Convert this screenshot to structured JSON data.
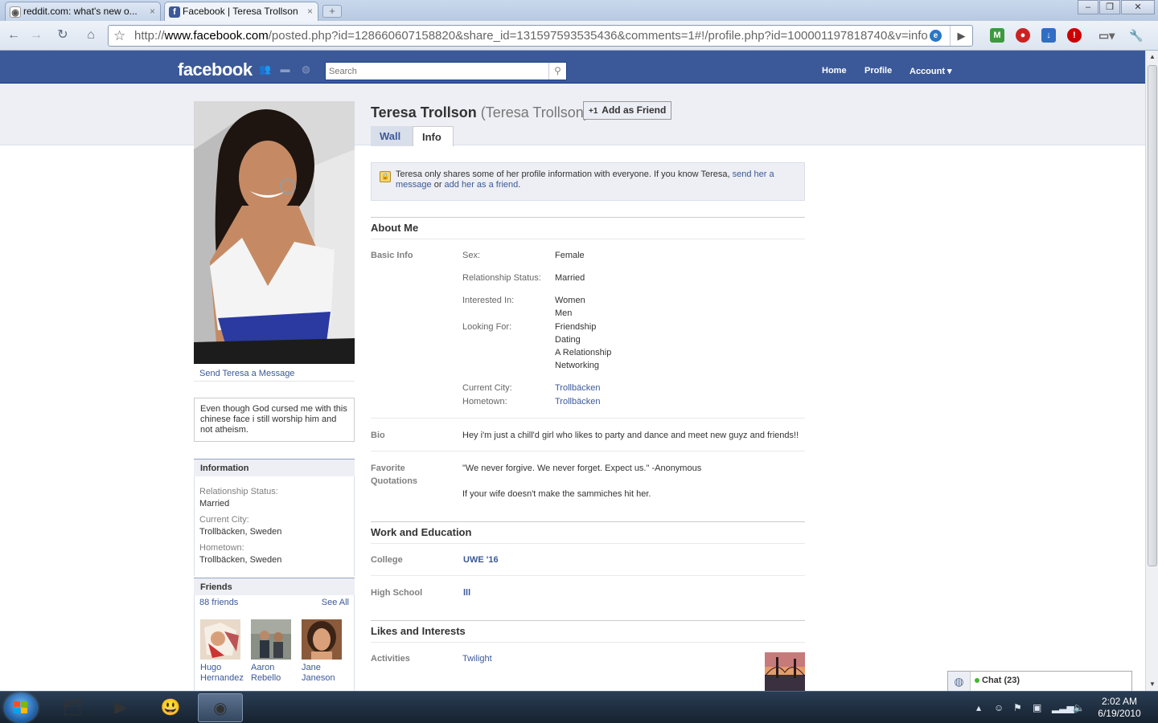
{
  "browser": {
    "tabs": [
      {
        "title": "reddit.com: what's new o...",
        "close": "×"
      },
      {
        "title": "Facebook | Teresa Trollson",
        "close": "×"
      }
    ],
    "url_prefix": "http://",
    "url_host": "www.facebook.com",
    "url_rest": "/posted.php?id=128660607158820&share_id=131597593535436&comments=1#!/profile.php?id=100001197818740&v=info"
  },
  "fb": {
    "logo": "facebook",
    "search_placeholder": "Search",
    "nav": {
      "home": "Home",
      "profile": "Profile",
      "account": "Account ▾"
    },
    "accent": "#3b5998"
  },
  "profile": {
    "name": "Teresa Trollson",
    "alt_name": "(Teresa Trollson)",
    "add_friend": "Add as Friend",
    "tabs": [
      "Wall",
      "Info"
    ],
    "send_message": "Send Teresa a Message",
    "bio_box": "Even though God cursed me with this chinese face i still worship him and not atheism.",
    "privacy": {
      "text": "Teresa only shares some of her profile information with everyone. If you know Teresa,",
      "link1": "send her a message",
      "or": "or",
      "link2": "add her as a friend",
      "end": "."
    }
  },
  "sidebar": {
    "information_title": "Information",
    "relationship_label": "Relationship Status:",
    "relationship_value": "Married",
    "city_label": "Current City:",
    "city_value": "Trollbäcken, Sweden",
    "hometown_label": "Hometown:",
    "hometown_value": "Trollbäcken, Sweden",
    "friends_title": "Friends",
    "friends_count": "88 friends",
    "see_all": "See All",
    "friends": [
      {
        "first": "Hugo",
        "last": "Hernandez"
      },
      {
        "first": "Aaron",
        "last": "Rebello"
      },
      {
        "first": "Jane",
        "last": "Janeson"
      }
    ]
  },
  "about": {
    "title": "About Me",
    "basic_info": "Basic Info",
    "sex_label": "Sex:",
    "sex": "Female",
    "rel_label": "Relationship Status:",
    "rel": "Married",
    "interested_label": "Interested In:",
    "interested": [
      "Women",
      "Men"
    ],
    "looking_label": "Looking For:",
    "looking": [
      "Friendship",
      "Dating",
      "A Relationship",
      "Networking"
    ],
    "city_label": "Current City:",
    "city": "Trollbäcken",
    "hometown_label": "Hometown:",
    "hometown": "Trollbäcken",
    "bio_label": "Bio",
    "bio": "Hey i'm just a chill'd girl who likes to party and dance and meet new guyz and friends!!",
    "quotes_label_1": "Favorite",
    "quotes_label_2": "Quotations",
    "quote_1": "\"We never forgive. We never forget. Expect us.\" -Anonymous",
    "quote_2": "If your wife doesn't make the sammiches hit her."
  },
  "work": {
    "title": "Work and Education",
    "college_label": "College",
    "college": "UWE '16",
    "highschool_label": "High School",
    "highschool": "lll"
  },
  "likes": {
    "title": "Likes and Interests",
    "activities_label": "Activities",
    "activities": "Twilight"
  },
  "chat": {
    "label": "Chat (23)"
  },
  "taskbar": {
    "time": "2:02 AM",
    "date": "6/19/2010"
  }
}
